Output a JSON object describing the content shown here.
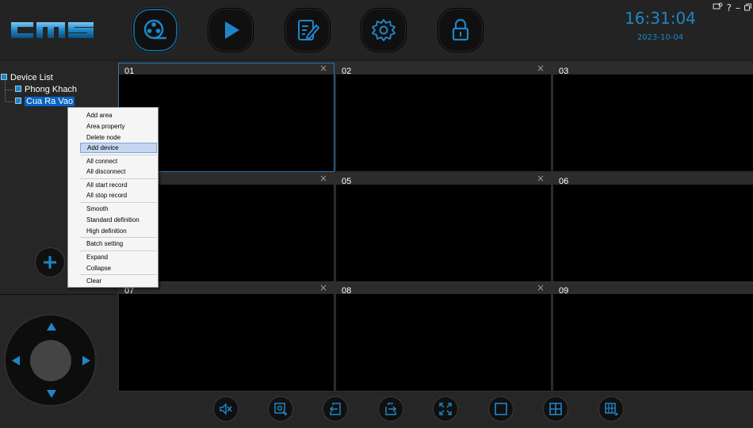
{
  "app": {
    "logo_text": "CMS"
  },
  "topbar": {
    "buttons": [
      {
        "id": "preview",
        "icon": "film-reel-icon",
        "active": true
      },
      {
        "id": "playback",
        "icon": "play-icon",
        "active": false
      },
      {
        "id": "log",
        "icon": "edit-document-icon",
        "active": false
      },
      {
        "id": "settings",
        "icon": "gear-icon",
        "active": false
      },
      {
        "id": "lock",
        "icon": "lock-icon",
        "active": false
      }
    ],
    "clock": "16:31:04",
    "date": "2023-10-04",
    "window_controls": {
      "help": "?",
      "minimize": "–"
    }
  },
  "tree": {
    "root": "Device List",
    "children": [
      "Phong Khach",
      "Cua Ra Vao"
    ],
    "selected": "Cua Ra Vao"
  },
  "context_menu": {
    "items": [
      "Add area",
      "Area property",
      "Delete node",
      "Add device",
      "All connect",
      "All disconnect",
      "All start record",
      "All stop record",
      "Smooth",
      "Standard definition",
      "High definition",
      "Batch setting",
      "Expand",
      "Collapse",
      "Clear"
    ],
    "highlighted": "Add device"
  },
  "grid": {
    "cells": [
      {
        "num": "01",
        "close": "×"
      },
      {
        "num": "02",
        "close": "×"
      },
      {
        "num": "03",
        "close": ""
      },
      {
        "num": "",
        "close": "×"
      },
      {
        "num": "05",
        "close": "×"
      },
      {
        "num": "06",
        "close": ""
      },
      {
        "num": "07",
        "close": "×"
      },
      {
        "num": "08",
        "close": "×"
      },
      {
        "num": "09",
        "close": ""
      }
    ]
  },
  "bottombar": {
    "buttons": [
      {
        "id": "mute",
        "icon": "mute-speaker-icon"
      },
      {
        "id": "snapshot",
        "icon": "snapshot-icon"
      },
      {
        "id": "prev-page",
        "icon": "page-prev-icon"
      },
      {
        "id": "next-page",
        "icon": "page-next-icon"
      },
      {
        "id": "fullscreen",
        "icon": "fullscreen-icon"
      },
      {
        "id": "layout-1",
        "icon": "layout-single-icon"
      },
      {
        "id": "layout-4",
        "icon": "layout-quad-icon"
      },
      {
        "id": "layout-custom",
        "icon": "layout-custom-icon"
      }
    ]
  },
  "colors": {
    "accent": "#1e86c8",
    "selection": "#0a63c4",
    "background": "#262626"
  }
}
